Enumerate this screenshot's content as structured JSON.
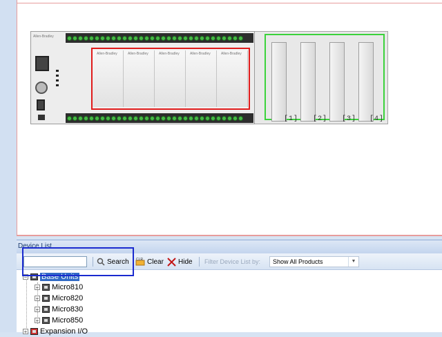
{
  "device_list": {
    "title": "Device List",
    "search_value": "",
    "search_label": "Search",
    "clear_label": "Clear",
    "hide_label": "Hide",
    "filter_label": "Filter Device List by:",
    "filter_value": "Show All Products"
  },
  "tree": {
    "root_label": "Base Units",
    "items": [
      {
        "label": "Micro810"
      },
      {
        "label": "Micro820"
      },
      {
        "label": "Micro830"
      },
      {
        "label": "Micro850"
      }
    ],
    "next_root_label": "Expansion I/O"
  },
  "device": {
    "brand": "Allen-Bradley",
    "expansion_labels": [
      "[1]",
      "[2]",
      "[3]",
      "[4]"
    ],
    "io_slot_label": "Allen-Bradley"
  },
  "colors": {
    "io_frame": "#e01a1a",
    "expansion_frame": "#3ad23a",
    "highlight": "#1a2acf",
    "selected": "#316ac5"
  },
  "icons": [
    "search-icon",
    "clear-icon",
    "hide-icon",
    "expand-icon",
    "controller-icon",
    "dropdown-arrow-icon"
  ]
}
